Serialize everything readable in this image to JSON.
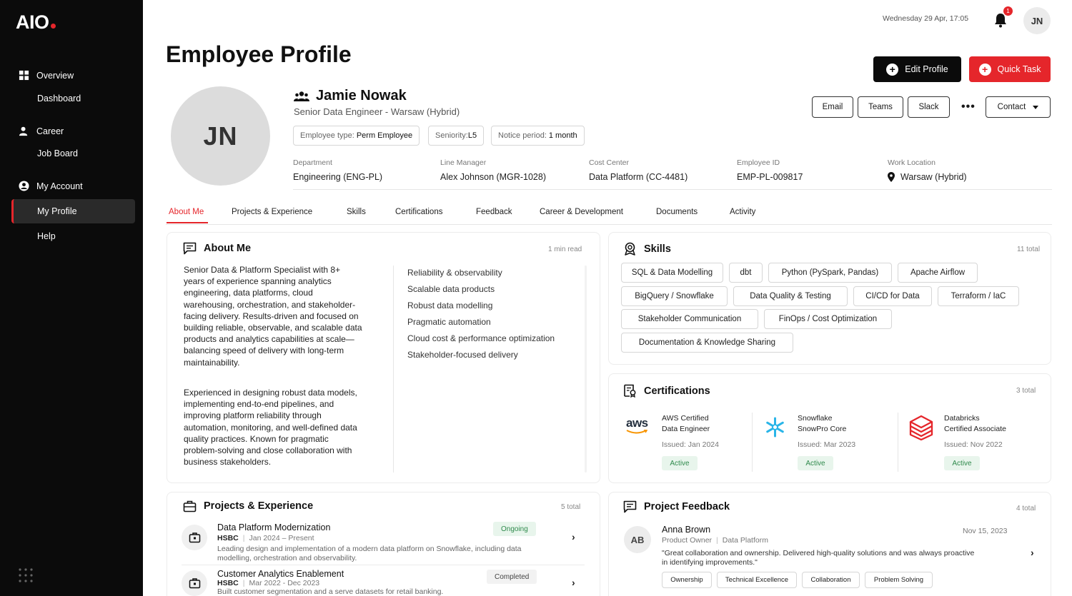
{
  "app": {
    "logo": "AIO"
  },
  "sidebar": {
    "overview": "Overview",
    "dashboard": "Dashboard",
    "career": "Career",
    "job_board": "Job Board",
    "my_account": "My Account",
    "my_profile": "My Profile",
    "help": "Help"
  },
  "topbar": {
    "datetime": "Wednesday 29 Apr, 17:05",
    "notifications": "1",
    "avatar_initials": "JN"
  },
  "page": {
    "title": "Employee Profile",
    "edit_label": "Edit Profile",
    "quick_task_label": "Quick Task"
  },
  "profile": {
    "initials": "JN",
    "name": "Jamie Nowak",
    "role": "Senior Data Engineer - Warsaw (Hybrid)",
    "pills": [
      {
        "label": "Employee type:",
        "value": "Perm Employee"
      },
      {
        "label": "Seniority:",
        "value": "L5"
      },
      {
        "label": "Notice period:",
        "value": "1 month"
      }
    ],
    "actions": {
      "email": "Email",
      "teams": "Teams",
      "slack": "Slack",
      "more": "•••",
      "contact": "Contact"
    },
    "info": [
      {
        "label": "Department",
        "value": "Engineering (ENG-PL)"
      },
      {
        "label": "Line Manager",
        "value": "Alex Johnson (MGR-1028)"
      },
      {
        "label": "Cost Center",
        "value": "Data Platform (CC-4481)"
      },
      {
        "label": "Employee ID",
        "value": "EMP-PL-009817"
      },
      {
        "label": "Work Location",
        "value": "Warsaw (Hybrid)"
      }
    ]
  },
  "tabs": [
    "About Me",
    "Projects & Experience",
    "Skills",
    "Certifications",
    "Feedback",
    "Career & Development",
    "Documents",
    "Activity"
  ],
  "about": {
    "title": "About Me",
    "meta": "1 min read",
    "para1": "Senior Data & Platform Specialist with 8+ years of experience spanning analytics engineering, data platforms, cloud warehousing, orchestration, and stakeholder-facing delivery. Results-driven and focused on building reliable, observable, and scalable data products and analytics capabilities at scale—balancing speed of delivery with long-term maintainability.",
    "para2": "Experienced in designing robust data models, implementing end-to-end pipelines, and improving platform reliability through automation, monitoring, and well-defined data quality practices. Known for pragmatic problem-solving and close collaboration with business stakeholders.",
    "highlights": [
      "Reliability & observability",
      "Scalable data products",
      "Robust data modelling",
      "Pragmatic automation",
      "Cloud cost & performance optimization",
      "Stakeholder-focused delivery"
    ]
  },
  "skills": {
    "title": "Skills",
    "meta": "11 total",
    "items": [
      "SQL & Data Modelling",
      "dbt",
      "Python (PySpark, Pandas)",
      "Apache Airflow",
      "BigQuery / Snowflake",
      "Data Quality & Testing",
      "CI/CD for Data",
      "Terraform / IaC",
      "Stakeholder Communication",
      "FinOps / Cost Optimization",
      "Documentation & Knowledge Sharing"
    ]
  },
  "certifications": {
    "title": "Certifications",
    "meta": "3 total",
    "items": [
      {
        "logo": "aws",
        "line1": "AWS Certified",
        "line2": "Data Engineer",
        "issued": "Issued: Jan 2024",
        "status": "Active"
      },
      {
        "logo": "snowflake-icon",
        "line1": "Snowflake",
        "line2": "SnowPro Core",
        "issued": "Issued: Mar 2023",
        "status": "Active"
      },
      {
        "logo": "databricks-icon",
        "line1": "Databricks",
        "line2": "Certified Associate",
        "issued": "Issued: Nov 2022",
        "status": "Active"
      }
    ]
  },
  "projects": {
    "title": "Projects & Experience",
    "meta": "5 total",
    "items": [
      {
        "title": "Data Platform Modernization",
        "company": "HSBC",
        "dates": "Jan 2024 – Present",
        "desc": "Leading design and implementation of a modern data platform on Snowflake, including data modelling, orchestration and observability.",
        "status": "Ongoing"
      },
      {
        "title": "Customer Analytics Enablement",
        "company": "HSBC",
        "dates": "Mar 2022 - Dec 2023",
        "desc": "Built customer segmentation and a serve datasets for retail banking.",
        "status": "Completed"
      }
    ]
  },
  "feedback": {
    "title": "Project Feedback",
    "meta": "4 total",
    "item": {
      "initials": "AB",
      "name": "Anna Brown",
      "role": "Product Owner",
      "team": "Data Platform",
      "date": "Nov 15, 2023",
      "quote": "\"Great collaboration and ownership. Delivered high-quality solutions and was always proactive in identifying improvements.\"",
      "tags": [
        "Ownership",
        "Technical Excellence",
        "Collaboration",
        "Problem Solving"
      ]
    }
  },
  "colors": {
    "accent": "#e5262b",
    "dark": "#0b0b0b",
    "success": "#2f8a4c"
  }
}
